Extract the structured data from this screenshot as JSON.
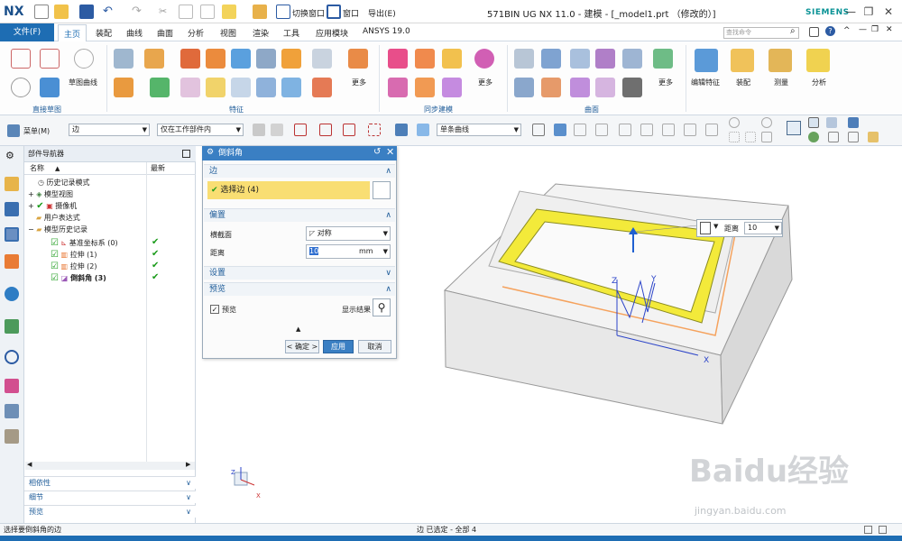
{
  "app": {
    "logo": "NX",
    "window_title": "571BIN UG NX 11.0 - 建模 - [_model1.prt （修改的）]",
    "brand": "SIEMENS",
    "quick_access": {
      "switch_window": "切换窗口",
      "window": "窗口",
      "export": "导出(E)"
    }
  },
  "ribbon": {
    "file_tab": "文件(F)",
    "tabs": [
      "主页",
      "装配",
      "曲线",
      "曲面",
      "分析",
      "视图",
      "渲染",
      "工具",
      "应用模块",
      "ANSYS 19.0"
    ],
    "active_tab": "主页",
    "search_placeholder": "查找命令",
    "labels": {
      "sketch_curve": "草图曲线",
      "more": "更多",
      "sync_features": "编辑特征",
      "assembly": "装配",
      "measure": "测量",
      "analysis": "分析"
    },
    "groups": [
      "直接草图",
      "特征",
      "同步建模",
      "曲面"
    ]
  },
  "toolbar": {
    "menu_label": "菜单(M)",
    "selection_filter": "边",
    "scope": "仅在工作部件内",
    "curve_rule": "单条曲线"
  },
  "navigator": {
    "title": "部件导航器",
    "col_name": "名称",
    "col_latest": "最新",
    "rows": [
      {
        "label": "历史记录模式",
        "indent": 0,
        "latest": ""
      },
      {
        "label": "模型视图",
        "indent": 0,
        "latest": ""
      },
      {
        "label": "摄像机",
        "indent": 0,
        "latest": ""
      },
      {
        "label": "用户表达式",
        "indent": 0,
        "latest": ""
      },
      {
        "label": "模型历史记录",
        "indent": 0,
        "latest": ""
      },
      {
        "label": "基准坐标系 (0)",
        "indent": 1,
        "latest": "✔"
      },
      {
        "label": "拉伸 (1)",
        "indent": 1,
        "latest": "✔"
      },
      {
        "label": "拉伸 (2)",
        "indent": 1,
        "latest": "✔"
      },
      {
        "label": "倒斜角 (3)",
        "indent": 1,
        "latest": "✔"
      }
    ],
    "accordions": [
      "相依性",
      "细节",
      "预览"
    ]
  },
  "dialog": {
    "title": "倒斜角",
    "edge_section": "边",
    "select_edge": "选择边 (4)",
    "offset_section": "偏置",
    "cross_section_label": "横截面",
    "cross_section_value": "对称",
    "distance_label": "距离",
    "distance_value": "10",
    "distance_unit": "mm",
    "settings_section": "设置",
    "preview_section": "预览",
    "preview_label": "预览",
    "show_result": "显示结果",
    "ok": "< 确定 >",
    "apply": "应用",
    "cancel": "取消"
  },
  "viewport": {
    "floating_label": "距离",
    "floating_value": "10",
    "axis_x": "X",
    "axis_y": "Y",
    "axis_z": "Z"
  },
  "status": {
    "left": "选择要倒斜角的边",
    "center": "边 已选定 - 全部 4"
  },
  "watermark": {
    "brand": "Baidu经验",
    "url": "jingyan.baidu.com"
  },
  "colors": {
    "accent": "#1e6db3",
    "highlight": "#f3ea3a",
    "selection": "#f5a25d"
  }
}
